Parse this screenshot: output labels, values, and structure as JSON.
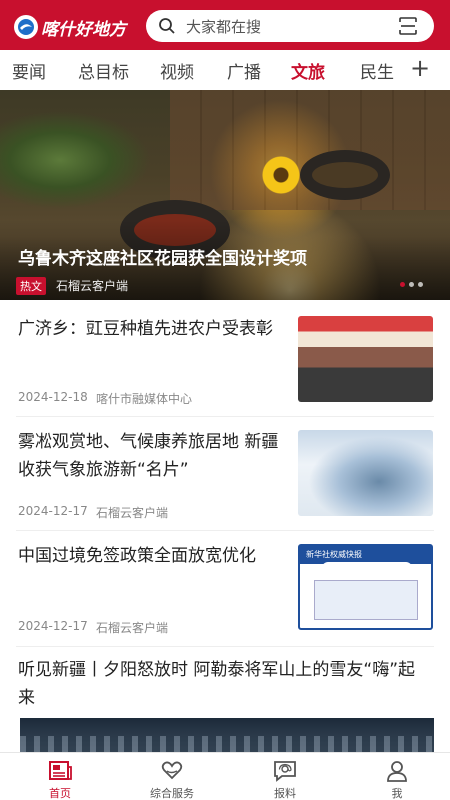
{
  "header": {
    "logo_text": "喀什好地方",
    "search_placeholder": "大家都在搜",
    "brand_color": "#c8102e"
  },
  "tabs": [
    {
      "label": "要闻",
      "active": false
    },
    {
      "label": "总目标",
      "active": false
    },
    {
      "label": "视频",
      "active": false
    },
    {
      "label": "广播",
      "active": false
    },
    {
      "label": "文旅",
      "active": true
    },
    {
      "label": "民生",
      "active": false
    }
  ],
  "tabs_more": "+",
  "hero": {
    "title": "乌鲁木齐这座社区花园获全国设计奖项",
    "badge": "热文",
    "source": "石榴云客户端"
  },
  "news": [
    {
      "title": "广济乡：豇豆种植先进农户受表彰",
      "date": "2024-12-18",
      "source": "喀什市融媒体中心"
    },
    {
      "title": "雾凇观赏地、气候康养旅居地 新疆收获气象旅游新“名片”",
      "date": "2024-12-17",
      "source": "石榴云客户端"
    },
    {
      "title": "中国过境免签政策全面放宽优化",
      "date": "2024-12-17",
      "source": "石榴云客户端",
      "thumb_header": "新华社权威快报"
    },
    {
      "title": "听见新疆丨夕阳怒放时 阿勒泰将军山上的雪友“嗨”起来"
    }
  ],
  "bottom_nav": [
    {
      "label": "首页",
      "icon": "newspaper-icon",
      "active": true
    },
    {
      "label": "综合服务",
      "icon": "heart-hands-icon",
      "active": false
    },
    {
      "label": "报料",
      "icon": "chat-at-icon",
      "active": false
    },
    {
      "label": "我",
      "icon": "user-icon",
      "active": false
    }
  ]
}
